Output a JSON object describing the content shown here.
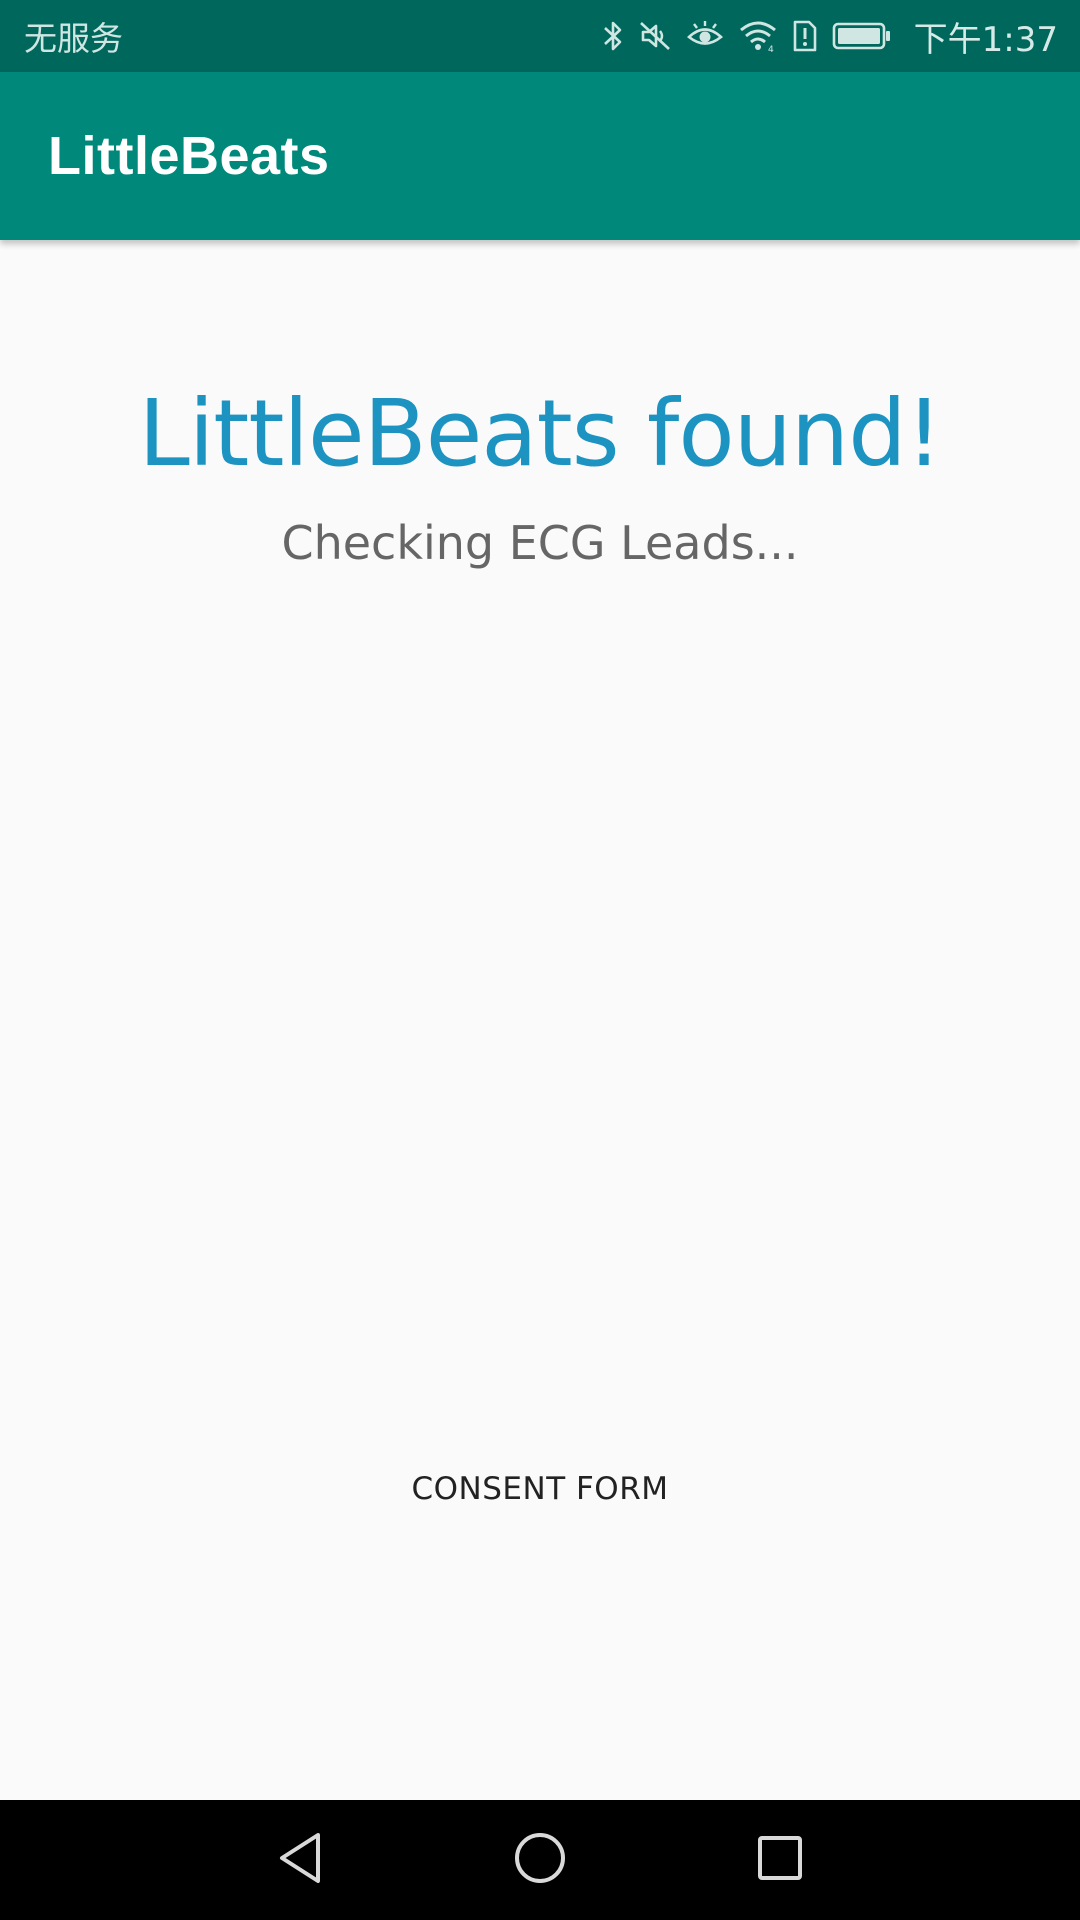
{
  "status_bar": {
    "carrier": "无服务",
    "time": "下午1:37",
    "icons": [
      "bluetooth-icon",
      "muted-icon",
      "eye-icon",
      "wifi-icon",
      "sim-alert-icon",
      "battery-icon"
    ]
  },
  "app_bar": {
    "title": "LittleBeats"
  },
  "main": {
    "headline": "LittleBeats found!",
    "subline": "Checking ECG Leads...",
    "consent_label": "CONSENT FORM"
  },
  "nav_bar": {
    "icons": [
      "back-icon",
      "home-icon",
      "recents-icon"
    ]
  },
  "colors": {
    "status_bar": "#00675c",
    "app_bar": "#00897b",
    "headline": "#1c93c1",
    "subline": "#666666",
    "background": "#fafafa"
  }
}
